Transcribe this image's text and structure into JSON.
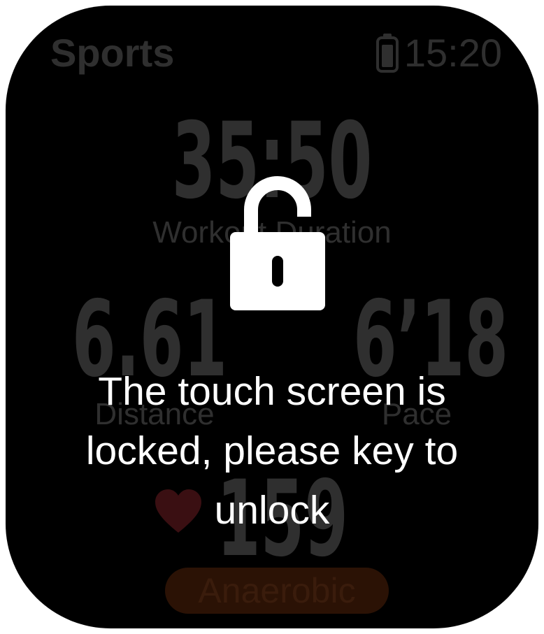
{
  "header": {
    "app_title": "Sports",
    "time": "15:20",
    "battery_icon": "battery-icon"
  },
  "metrics": {
    "duration": {
      "value": "35:50",
      "label": "Workout Duration"
    },
    "distance": {
      "value": "6.61",
      "label": "Distance"
    },
    "pace": {
      "value": "6’18",
      "label": "Pace"
    },
    "heart_rate": {
      "value": "159",
      "icon": "heart-icon"
    }
  },
  "zone": {
    "label": "Anaerobic"
  },
  "lock_overlay": {
    "icon": "lock-icon",
    "message": "The touch screen is locked, please key to unlock"
  },
  "colors": {
    "background": "#000000",
    "dim_text": "#2f2f2f",
    "overlay_text": "#ffffff",
    "heart": "#3a0f12",
    "zone_pill": "#2b1205"
  }
}
